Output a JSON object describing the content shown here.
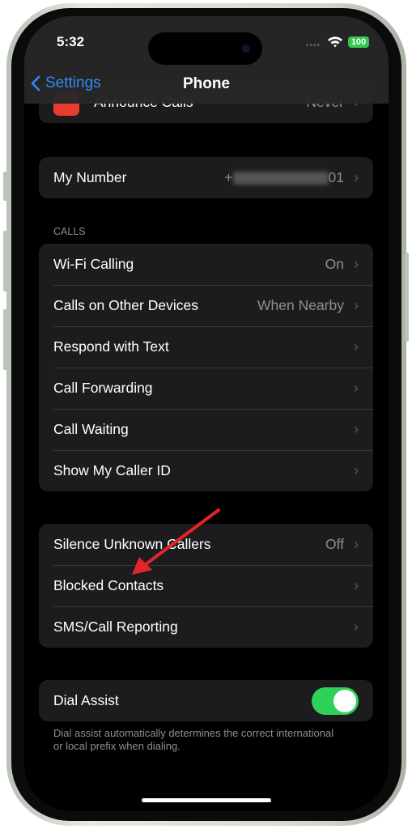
{
  "status": {
    "time": "5:32",
    "battery": "100"
  },
  "nav": {
    "back_label": "Settings",
    "title": "Phone"
  },
  "announce": {
    "label": "Announce Calls",
    "value": "Never"
  },
  "my_number": {
    "label": "My Number",
    "value_prefix": "+",
    "value_suffix": "01"
  },
  "calls_section": {
    "header": "CALLS",
    "rows": [
      {
        "label": "Wi-Fi Calling",
        "value": "On"
      },
      {
        "label": "Calls on Other Devices",
        "value": "When Nearby"
      },
      {
        "label": "Respond with Text",
        "value": ""
      },
      {
        "label": "Call Forwarding",
        "value": ""
      },
      {
        "label": "Call Waiting",
        "value": ""
      },
      {
        "label": "Show My Caller ID",
        "value": ""
      }
    ]
  },
  "blocking_section": {
    "rows": [
      {
        "label": "Silence Unknown Callers",
        "value": "Off"
      },
      {
        "label": "Blocked Contacts",
        "value": ""
      },
      {
        "label": "SMS/Call Reporting",
        "value": ""
      }
    ]
  },
  "dial_assist": {
    "label": "Dial Assist",
    "enabled": true,
    "footer": "Dial assist automatically determines the correct international or local prefix when dialing."
  },
  "colors": {
    "accent": "#2f8cf5",
    "toggle_on": "#30d158",
    "annotation_arrow": "#e5242a"
  }
}
